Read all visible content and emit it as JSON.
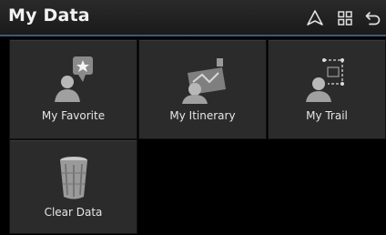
{
  "header": {
    "title": "My Data",
    "icons": [
      "navigation-icon",
      "grid-menu-icon",
      "back-icon"
    ]
  },
  "tiles": [
    {
      "label": "My Favorite",
      "icon": "favorite-person-icon"
    },
    {
      "label": "My Itinerary",
      "icon": "itinerary-map-icon"
    },
    {
      "label": "My Trail",
      "icon": "trail-icon"
    },
    {
      "label": "Clear Data",
      "icon": "trash-can-icon"
    }
  ],
  "colors": {
    "background": "#000000",
    "tile": "#2b2b2b",
    "header_divider": "#3b5b78",
    "text": "#e6e6e6"
  }
}
